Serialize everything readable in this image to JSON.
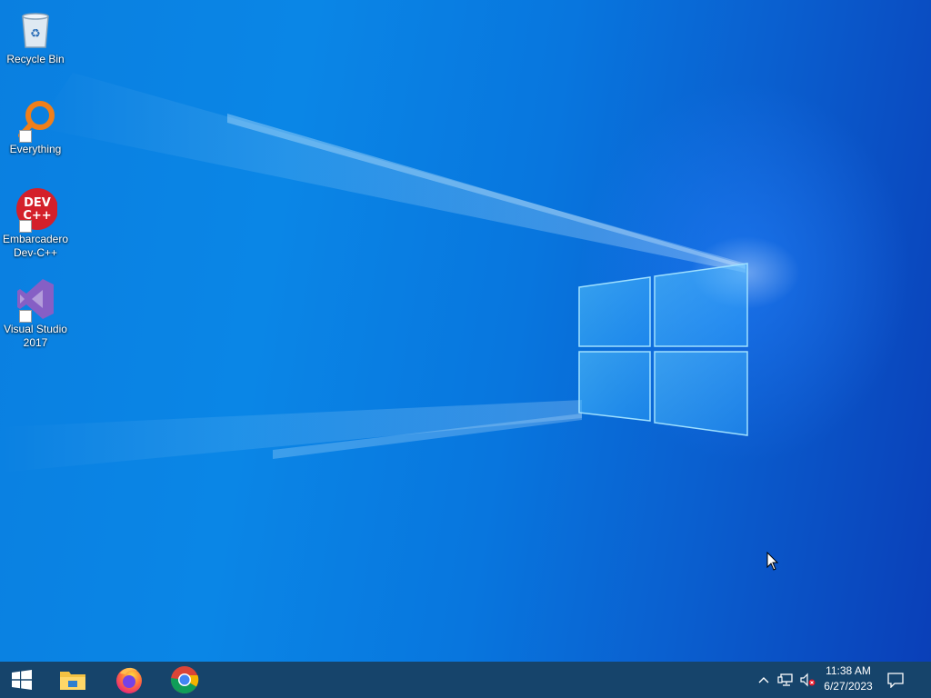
{
  "desktop": {
    "icons": [
      {
        "label": "Recycle Bin",
        "icon": "recycle-bin-icon"
      },
      {
        "label": "Everything",
        "icon": "everything-search-icon"
      },
      {
        "label": "Embarcadero Dev-C++",
        "icon": "dev-cpp-icon",
        "badge_text": "DEV C++"
      },
      {
        "label": "Visual Studio 2017",
        "icon": "visual-studio-icon"
      }
    ]
  },
  "taskbar": {
    "start": {
      "icon": "windows-start-icon"
    },
    "pinned": [
      {
        "name": "File Explorer",
        "icon": "file-explorer-icon"
      },
      {
        "name": "Firefox",
        "icon": "firefox-icon"
      },
      {
        "name": "Chrome",
        "icon": "chrome-icon"
      }
    ],
    "tray": {
      "show_hidden_icon": "chevron-up-icon",
      "network_icon": "network-icon",
      "volume_icon": "volume-muted-icon",
      "time": "11:38 AM",
      "date": "6/27/2023",
      "notifications_icon": "action-center-icon"
    }
  },
  "colors": {
    "taskbar": "#16446b",
    "desktop_accent": "#0a86e6"
  }
}
